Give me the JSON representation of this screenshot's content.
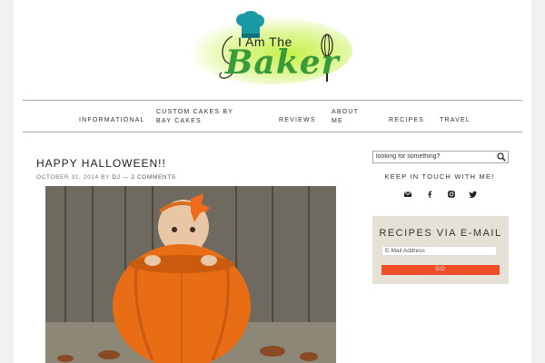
{
  "site": {
    "logo_small": "I Am The",
    "logo_main": "Baker"
  },
  "nav": {
    "items": [
      {
        "label": "Informational"
      },
      {
        "label": "Custom Cakes by Bay Cakes"
      },
      {
        "label": "Reviews"
      },
      {
        "label": "About Me"
      },
      {
        "label": "Recipes"
      },
      {
        "label": "Travel"
      }
    ]
  },
  "post": {
    "title": "HAPPY HALLOWEEN!!",
    "date": "OCTOBER 31, 2014",
    "by": "BY",
    "author": "DJ",
    "separator": "—",
    "comments": "2 COMMENTS"
  },
  "sidebar": {
    "search_placeholder": "looking for something?",
    "keep_in_touch": "KEEP IN TOUCH WITH ME!",
    "social_icons": [
      "email-icon",
      "facebook-icon",
      "instagram-icon",
      "twitter-icon"
    ],
    "subscribe": {
      "title": "RECIPES VIA E-MAIL",
      "email_placeholder": "E-Mail Address",
      "go_label": "GO"
    }
  },
  "colors": {
    "accent": "#ef4e27",
    "logo_green": "#3a9a3a",
    "chef_hat": "#1b9aa3",
    "subscribe_bg": "#e6e1d6"
  }
}
